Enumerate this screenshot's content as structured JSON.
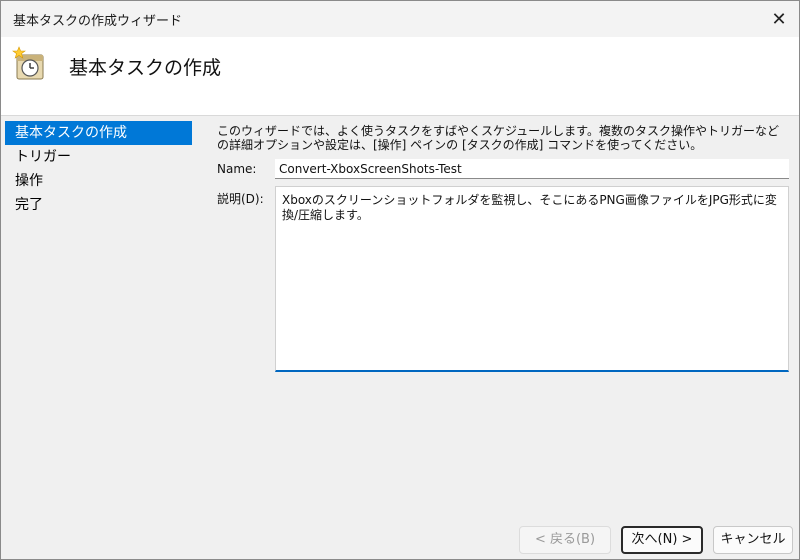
{
  "window": {
    "title": "基本タスクの作成ウィザード",
    "close_glyph": "✕"
  },
  "header": {
    "title": "基本タスクの作成",
    "icon": "task-clock-icon"
  },
  "steps": [
    {
      "label": "基本タスクの作成",
      "active": true
    },
    {
      "label": "トリガー",
      "active": false
    },
    {
      "label": "操作",
      "active": false
    },
    {
      "label": "完了",
      "active": false
    }
  ],
  "main": {
    "description": "このウィザードでは、よく使うタスクをすばやくスケジュールします。複数のタスク操作やトリガーなどの詳細オプションや設定は、[操作] ペインの [タスクの作成] コマンドを使ってください。",
    "name_label": "Name:",
    "name_value": "Convert-XboxScreenShots-Test",
    "desc_label": "説明(D):",
    "desc_value": "Xboxのスクリーンショットフォルダを監視し、そこにあるPNG画像ファイルをJPG形式に変換/圧縮します。"
  },
  "footer": {
    "back_label": "< 戻る(B)",
    "next_label": "次へ(N) >",
    "cancel_label": "キャンセル"
  },
  "colors": {
    "accent": "#0078d7",
    "window_bg": "#f0f0f0",
    "header_bg": "#ffffff"
  }
}
